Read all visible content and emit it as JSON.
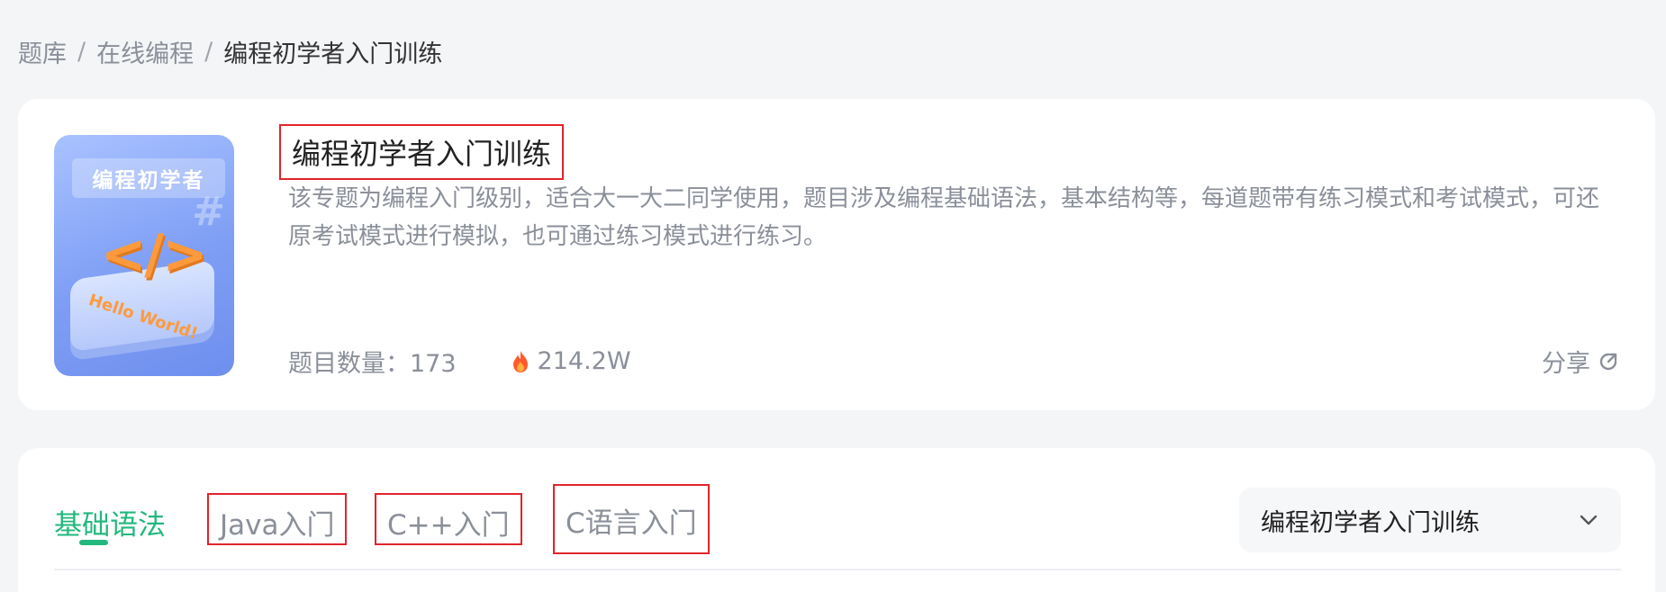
{
  "breadcrumb": {
    "items": [
      "题库",
      "在线编程",
      "编程初学者入门训练"
    ],
    "separator": "/"
  },
  "course": {
    "cover_title": "编程初学者",
    "cover_glyph": "</>",
    "cover_hash": "#",
    "cover_hello": "Hello World!",
    "title": "编程初学者入门训练",
    "description": "该专题为编程入门级别，适合大一大二同学使用，题目涉及编程基础语法，基本结构等，每道题带有练习模式和考试模式，可还原考试模式进行模拟，也可通过练习模式进行练习。",
    "count_label": "题目数量：173",
    "heat": "214.2W",
    "share_label": "分享"
  },
  "tabs": [
    {
      "label": "基础语法",
      "active": true
    },
    {
      "label": "Java入门",
      "active": false
    },
    {
      "label": "C++入门",
      "active": false
    },
    {
      "label": "C语言入门",
      "active": false
    }
  ],
  "select": {
    "value": "编程初学者入门训练"
  },
  "colors": {
    "accent": "#22b87e",
    "highlight_box": "#e0252b",
    "fire": "#ff5a2c"
  }
}
